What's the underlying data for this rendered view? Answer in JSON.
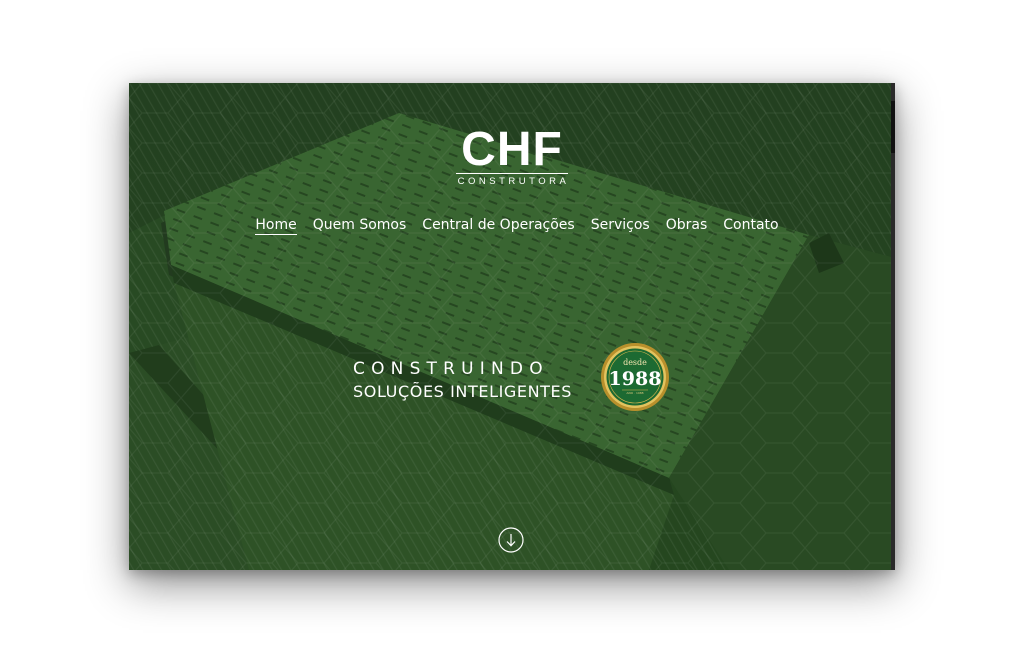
{
  "brand": {
    "name": "CHF",
    "subtitle": "CONSTRUTORA"
  },
  "nav": {
    "items": [
      {
        "label": "Home",
        "active": true
      },
      {
        "label": "Quem Somos"
      },
      {
        "label": "Central de Operações"
      },
      {
        "label": "Serviços"
      },
      {
        "label": "Obras"
      },
      {
        "label": "Contato"
      }
    ]
  },
  "hero": {
    "line1": "CONSTRUINDO",
    "line2": "SOLUÇÕES INTELIGENTES"
  },
  "seal": {
    "top_text": "desde",
    "year": "1988",
    "bottom_text": "ANO · 1988"
  },
  "colors": {
    "overlay_green": "#2e5a27",
    "seal_gold": "#c9a43a",
    "seal_green": "#1d6a32",
    "text": "#ffffff"
  },
  "icons": {
    "scroll_down": "arrow-down-circle-icon"
  }
}
